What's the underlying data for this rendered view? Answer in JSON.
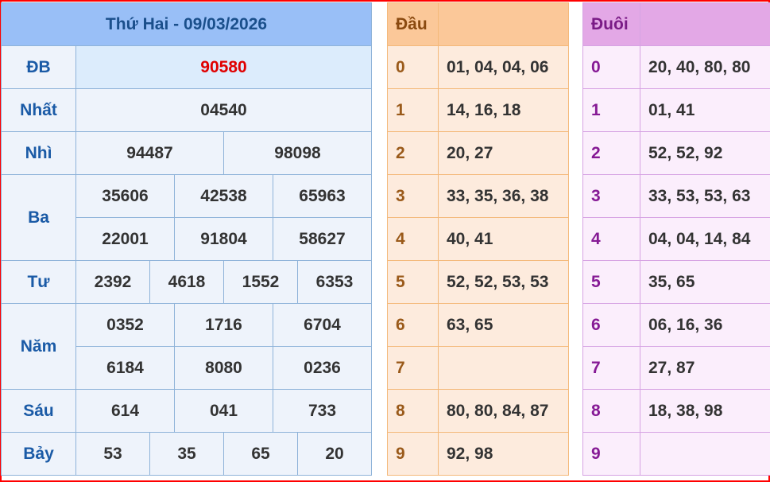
{
  "results": {
    "title": "Thứ Hai - 09/03/2026",
    "rows": {
      "db": {
        "label": "ĐB",
        "values": [
          "90580"
        ]
      },
      "nhat": {
        "label": "Nhất",
        "values": [
          "04540"
        ]
      },
      "nhi": {
        "label": "Nhì",
        "values": [
          "94487",
          "98098"
        ]
      },
      "ba": {
        "label": "Ba",
        "values": [
          "35606",
          "42538",
          "65963",
          "22001",
          "91804",
          "58627"
        ]
      },
      "tu": {
        "label": "Tư",
        "values": [
          "2392",
          "4618",
          "1552",
          "6353"
        ]
      },
      "nam": {
        "label": "Năm",
        "values": [
          "0352",
          "1716",
          "6704",
          "6184",
          "8080",
          "0236"
        ]
      },
      "sau": {
        "label": "Sáu",
        "values": [
          "614",
          "041",
          "733"
        ]
      },
      "bay": {
        "label": "Bảy",
        "values": [
          "53",
          "35",
          "65",
          "20"
        ]
      }
    }
  },
  "dau": {
    "header": "Đầu",
    "rows": [
      {
        "key": "0",
        "values": "01, 04, 04, 06"
      },
      {
        "key": "1",
        "values": "14, 16, 18"
      },
      {
        "key": "2",
        "values": "20, 27"
      },
      {
        "key": "3",
        "values": "33, 35, 36, 38"
      },
      {
        "key": "4",
        "values": "40, 41"
      },
      {
        "key": "5",
        "values": "52, 52, 53, 53"
      },
      {
        "key": "6",
        "values": "63, 65"
      },
      {
        "key": "7",
        "values": ""
      },
      {
        "key": "8",
        "values": "80, 80, 84, 87"
      },
      {
        "key": "9",
        "values": "92, 98"
      }
    ]
  },
  "duoi": {
    "header": "Đuôi",
    "rows": [
      {
        "key": "0",
        "values": "20, 40, 80, 80"
      },
      {
        "key": "1",
        "values": "01, 41"
      },
      {
        "key": "2",
        "values": "52, 52, 92"
      },
      {
        "key": "3",
        "values": "33, 53, 53, 63"
      },
      {
        "key": "4",
        "values": "04, 04, 14, 84"
      },
      {
        "key": "5",
        "values": "35, 65"
      },
      {
        "key": "6",
        "values": "06, 16, 36"
      },
      {
        "key": "7",
        "values": "27, 87"
      },
      {
        "key": "8",
        "values": "18, 38, 98"
      },
      {
        "key": "9",
        "values": ""
      }
    ]
  }
}
